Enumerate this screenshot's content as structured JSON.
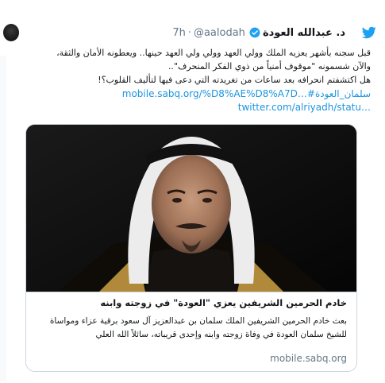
{
  "header": {
    "author_name": "د. عبدالله العودة",
    "handle": "@aalodah",
    "separator": "·",
    "time": "7h"
  },
  "tweet_text": {
    "lines": [
      "قبل سجنه بأشهر يعزيه الملك وولي العهد وولي ولي العهد حينها.. ويعطونه الأمان والثقة،",
      "والآن شسمونه \"موقوف أمنياً من ذوي الفكر المنحرف\"..",
      "هل اكتشفتم انحرافه بعد ساعات من تغريدته التي دعى فيها لتأليف القلوب؟!"
    ],
    "link_1": "mobile.sabq.org/%D8%AE%D8%A7D…#سلمان_العودة",
    "link_2": "twitter.com/alriyadh/statu…"
  },
  "card": {
    "image_alt": "صورة الملك سلمان",
    "title": "خادم الحرمين الشريفين يعزي \"العودة\" في زوجته وابنه",
    "description_lines": [
      "بعث خادم الحرمين الشريفين الملك سلمان بن عبدالعزيز آل سعود برقية عزاء ومواساة",
      "للشيخ سلمان العودة في وفاة زوجته وابنه وإحدى قريباته، سائلاً الله العلي"
    ],
    "domain": "mobile.sabq.org"
  },
  "colors": {
    "link": "#1b95e0",
    "muted": "#657786",
    "border": "#ccd6dd",
    "twitter_blue": "#1da1f2"
  },
  "icons": [
    "twitter-bird-icon",
    "verified-badge-icon"
  ]
}
